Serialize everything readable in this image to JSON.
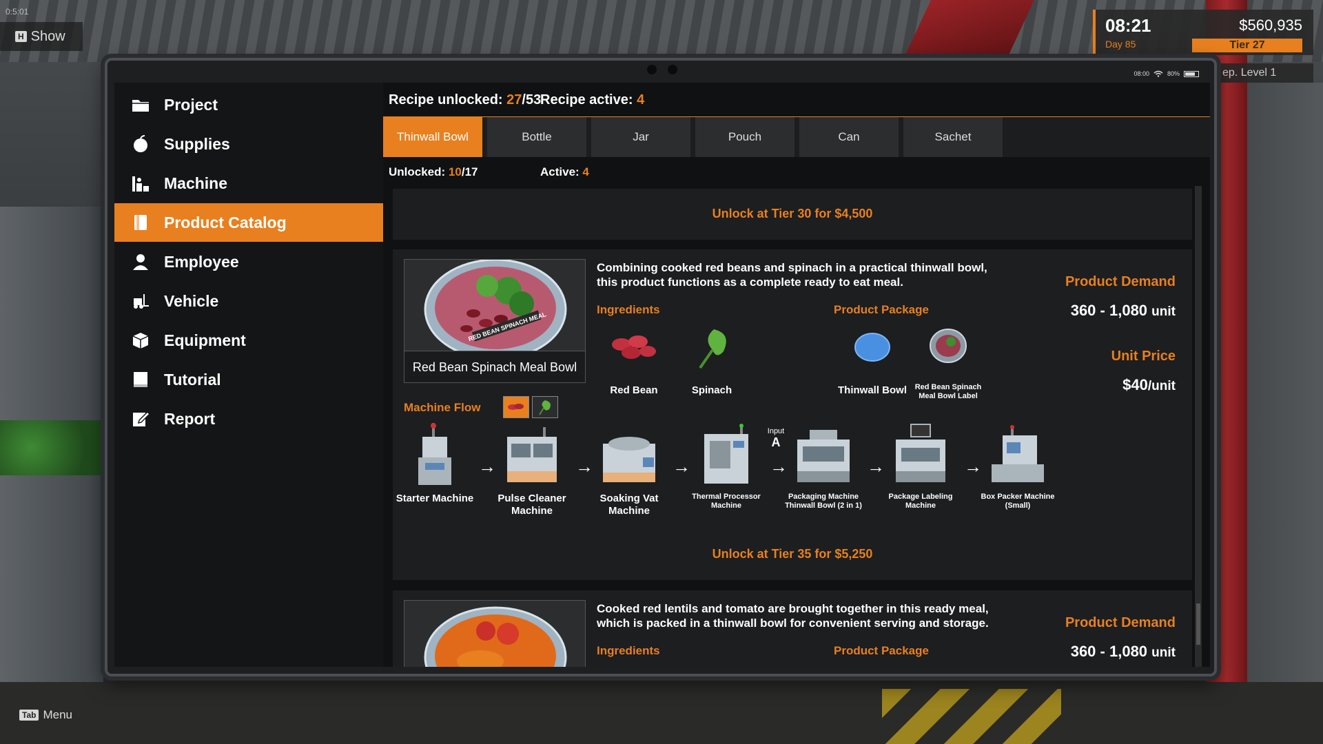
{
  "hud": {
    "corner_time": "0:5:01",
    "show_key": "H",
    "show_label": "Show",
    "menu_key": "Tab",
    "menu_label": "Menu",
    "time": "08:21",
    "day": "Day 85",
    "money": "$560,935",
    "tier": "Tier 27",
    "rep": "ep. Level 1"
  },
  "device": {
    "clock": "08:00",
    "battery": "80%"
  },
  "sidebar": {
    "items": [
      {
        "label": "Project",
        "icon": "folder-icon"
      },
      {
        "label": "Supplies",
        "icon": "supplies-icon"
      },
      {
        "label": "Machine",
        "icon": "machine-icon"
      },
      {
        "label": "Product Catalog",
        "icon": "catalog-icon"
      },
      {
        "label": "Employee",
        "icon": "employee-icon"
      },
      {
        "label": "Vehicle",
        "icon": "forklift-icon"
      },
      {
        "label": "Equipment",
        "icon": "equipment-icon"
      },
      {
        "label": "Tutorial",
        "icon": "book-icon"
      },
      {
        "label": "Report",
        "icon": "report-icon"
      }
    ],
    "active_index": 3
  },
  "header": {
    "unlocked_label": "Recipe unlocked:",
    "unlocked_value": "27",
    "unlocked_total": "/53",
    "active_label": "Recipe active:",
    "active_value": "4"
  },
  "tabs": [
    "Thinwall Bowl",
    "Bottle",
    "Jar",
    "Pouch",
    "Can",
    "Sachet"
  ],
  "sub": {
    "unlocked_label": "Unlocked:",
    "unlocked_value": "10",
    "unlocked_total": "/17",
    "active_label": "Active:",
    "active_value": "4"
  },
  "locked_top": {
    "text": "Unlock at Tier 30 for $4,500"
  },
  "product1": {
    "name": "Red Bean Spinach Meal Bowl",
    "bowl_text": "RED BEAN SPINACH MEAL",
    "description": "Combining cooked red beans and spinach in a practical thinwall bowl, this product functions as a complete ready to eat meal.",
    "ingredients_label": "Ingredients",
    "ingredients": [
      "Red Bean",
      "Spinach"
    ],
    "package_label": "Product Package",
    "packages": [
      "Thinwall Bowl",
      "Red Bean Spinach Meal Bowl Label"
    ],
    "demand_label": "Product Demand",
    "demand_min": "360",
    "demand_max": "1,080",
    "demand_unit": "unit",
    "price_label": "Unit Price",
    "price": "$40",
    "price_unit": "/unit",
    "flow_label": "Machine Flow",
    "input_label": "Input",
    "input_value": "A",
    "machines": [
      "Starter Machine",
      "Pulse Cleaner Machine",
      "Soaking Vat Machine",
      "Thermal Processor Machine",
      "Packaging Machine Thinwall Bowl (2 in 1)",
      "Package Labeling Machine",
      "Box Packer Machine (Small)"
    ],
    "unlock_text": "Unlock at Tier 35 for $5,250"
  },
  "product2": {
    "description": "Cooked red lentils and tomato are brought together in this ready meal, which is packed in a thinwall bowl for convenient serving and storage.",
    "ingredients_label": "Ingredients",
    "package_label": "Product Package",
    "demand_label": "Product Demand",
    "demand_min": "360",
    "demand_max": "1,080",
    "demand_unit": "unit"
  },
  "colors": {
    "accent": "#e8801f",
    "panel": "#1d1e20",
    "tab": "#2c2d2f"
  }
}
